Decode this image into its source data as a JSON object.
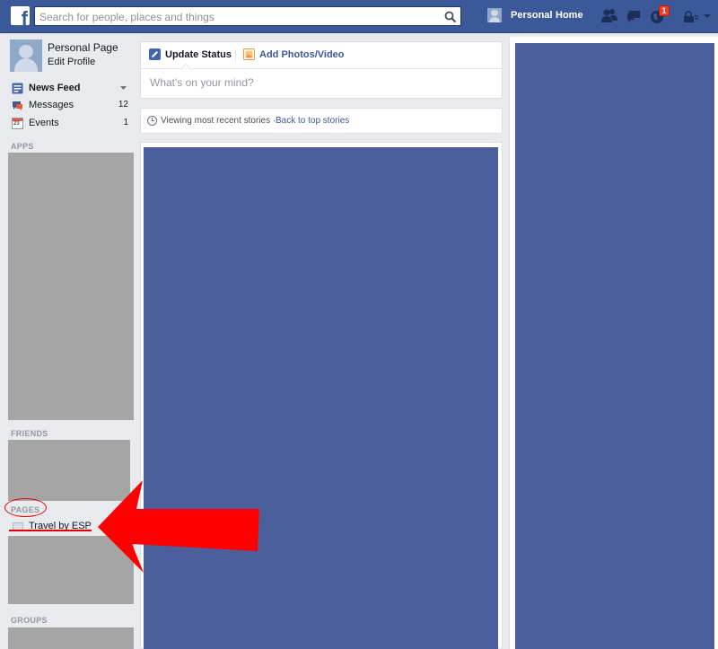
{
  "header": {
    "search_placeholder": "Search for people, places and things",
    "user_name": "Personal",
    "home_label": "Home",
    "notification_count": "1",
    "brand_color": "#3b5998"
  },
  "sidebar": {
    "profile_name": "Personal Page",
    "edit_profile": "Edit Profile",
    "nav": [
      {
        "label": "News Feed",
        "count": "",
        "icon": "news-feed-icon"
      },
      {
        "label": "Messages",
        "count": "12",
        "icon": "messages-icon"
      },
      {
        "label": "Events",
        "count": "1",
        "icon": "calendar-icon"
      }
    ],
    "calendar_date": "23",
    "sections": {
      "apps": "APPS",
      "friends": "FRIENDS",
      "pages": "PAGES",
      "groups": "GROUPS"
    },
    "pages_items": [
      {
        "label": "Travel by ESP"
      }
    ]
  },
  "composer": {
    "update_status": "Update Status",
    "add_photos": "Add Photos/Video",
    "placeholder": "What's on your mind?"
  },
  "feed": {
    "viewing_text": "Viewing most recent stories ·",
    "back_link": "Back to top stories"
  },
  "annotation": {
    "color": "#e60000"
  }
}
